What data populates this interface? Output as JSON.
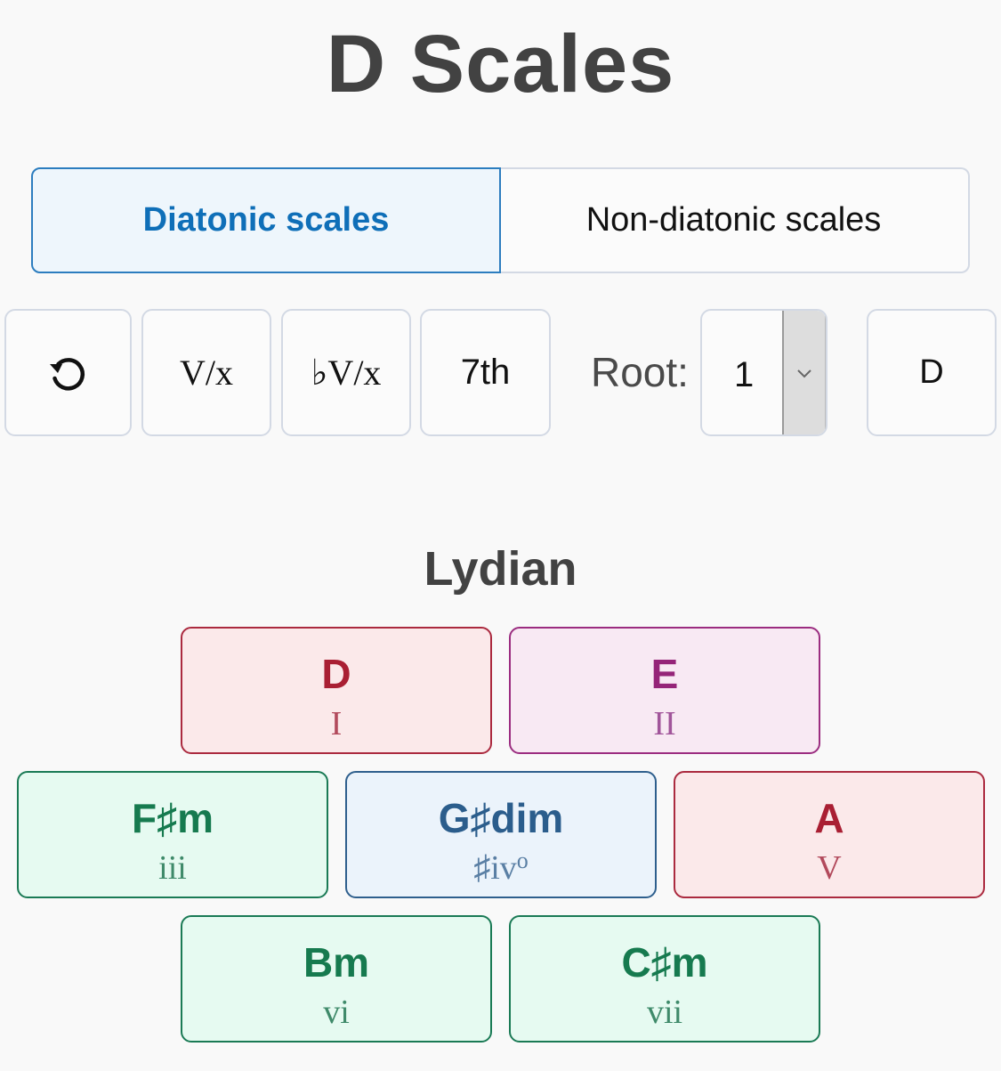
{
  "page": {
    "title": "D Scales"
  },
  "tabs": [
    {
      "label": "Diatonic scales",
      "selected": true
    },
    {
      "label": "Non-diatonic scales",
      "selected": false
    }
  ],
  "toolbar": {
    "reset_icon": "rotate-left-icon",
    "v_of_x_label": "V/x",
    "flat_v_of_x_label": "♭V/x",
    "seventh_label": "7th",
    "root_label": "Root:",
    "root_value": "1",
    "root_dropdown_icon": "chevron-down-icon",
    "note_label": "D"
  },
  "scale": {
    "name": "Lydian",
    "chords": [
      {
        "name": "D",
        "numeral": "I",
        "numeral_sup": "",
        "color": "#a91f33"
      },
      {
        "name": "E",
        "numeral": "II",
        "numeral_sup": "",
        "color": "#952478"
      },
      {
        "name": "F♯m",
        "numeral": "iii",
        "numeral_sup": "",
        "color": "#167a4f"
      },
      {
        "name": "G♯dim",
        "numeral": "♯iv",
        "numeral_sup": "o",
        "color": "#2b5d8c"
      },
      {
        "name": "A",
        "numeral": "V",
        "numeral_sup": "",
        "color": "#a91f33"
      },
      {
        "name": "Bm",
        "numeral": "vi",
        "numeral_sup": "",
        "color": "#167a4f"
      },
      {
        "name": "C♯m",
        "numeral": "vii",
        "numeral_sup": "",
        "color": "#167a4f"
      }
    ]
  }
}
